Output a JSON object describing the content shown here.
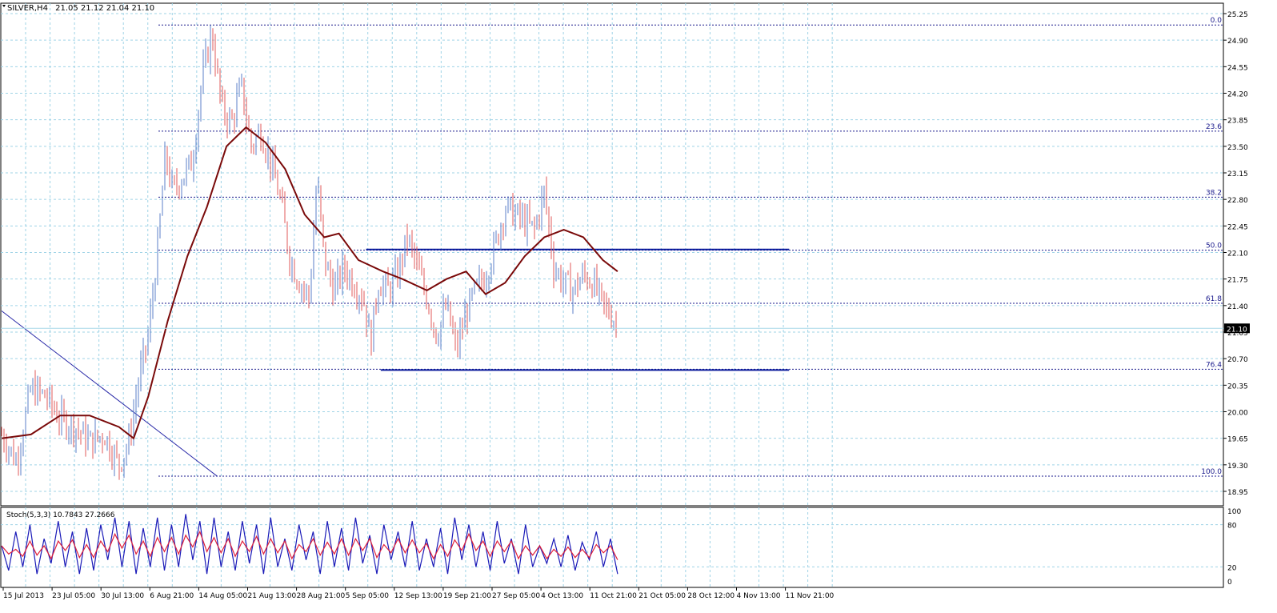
{
  "header": {
    "symbol_label": "SILVER,H4",
    "ohlc": "21.05 21.12 21.04 21.10"
  },
  "chart_data": {
    "type": "candlestick",
    "symbol": "SILVER",
    "timeframe": "H4",
    "last_ohlc": {
      "open": 21.05,
      "high": 21.12,
      "low": 21.04,
      "close": 21.1
    },
    "current_price_label": "21.10",
    "price_axis": {
      "ylim": [
        18.95,
        25.25
      ],
      "ticks": [
        "25.25",
        "24.90",
        "24.55",
        "24.20",
        "23.85",
        "23.50",
        "23.15",
        "22.80",
        "22.45",
        "22.10",
        "21.75",
        "21.40",
        "21.05",
        "20.70",
        "20.35",
        "20.00",
        "19.65",
        "19.30",
        "18.95"
      ]
    },
    "time_axis_labels": [
      "15 Jul 2013",
      "23 Jul 05:00",
      "30 Jul 13:00",
      "6 Aug 21:00",
      "14 Aug 05:00",
      "21 Aug 13:00",
      "28 Aug 21:00",
      "5 Sep 05:00",
      "12 Sep 13:00",
      "19 Sep 21:00",
      "27 Sep 05:00",
      "4 Oct 13:00",
      "11 Oct 21:00",
      "21 Oct 05:00",
      "28 Oct 12:00",
      "4 Nov 13:00",
      "11 Nov 21:00"
    ],
    "fibonacci": [
      {
        "label": "0.0",
        "price": 25.1
      },
      {
        "label": "23.6",
        "price": 23.7
      },
      {
        "label": "38.2",
        "price": 22.83
      },
      {
        "label": "50.0",
        "price": 22.13
      },
      {
        "label": "61.8",
        "price": 21.43
      },
      {
        "label": "76.4",
        "price": 20.56
      },
      {
        "label": "100.0",
        "price": 19.15
      }
    ],
    "horizontal_levels": [
      {
        "name": "resistance",
        "price": 22.14,
        "from_index": 5,
        "to_index": 13
      },
      {
        "name": "support",
        "price": 20.55,
        "from_index": 5.3,
        "to_index": 13
      }
    ],
    "trendline": {
      "from": {
        "index": 0,
        "price": 21.33
      },
      "to": {
        "index": 3.1,
        "price": 19.15
      }
    },
    "price_path": [
      {
        "i": 0.0,
        "p": 19.7
      },
      {
        "i": 0.3,
        "p": 19.35
      },
      {
        "i": 0.6,
        "p": 20.3
      },
      {
        "i": 0.9,
        "p": 20.2
      },
      {
        "i": 1.2,
        "p": 19.9
      },
      {
        "i": 1.5,
        "p": 19.8
      },
      {
        "i": 1.8,
        "p": 19.6
      },
      {
        "i": 2.1,
        "p": 19.7
      },
      {
        "i": 2.4,
        "p": 19.3
      },
      {
        "i": 2.6,
        "p": 19.6
      },
      {
        "i": 2.8,
        "p": 20.4
      },
      {
        "i": 3.0,
        "p": 21.0
      },
      {
        "i": 3.2,
        "p": 22.2
      },
      {
        "i": 3.35,
        "p": 23.4
      },
      {
        "i": 3.5,
        "p": 22.9
      },
      {
        "i": 3.7,
        "p": 23.1
      },
      {
        "i": 3.9,
        "p": 23.3
      },
      {
        "i": 4.1,
        "p": 24.4
      },
      {
        "i": 4.3,
        "p": 25.0
      },
      {
        "i": 4.5,
        "p": 24.0
      },
      {
        "i": 4.7,
        "p": 23.8
      },
      {
        "i": 4.9,
        "p": 24.3
      },
      {
        "i": 5.1,
        "p": 23.5
      },
      {
        "i": 5.3,
        "p": 23.7
      },
      {
        "i": 5.5,
        "p": 23.3
      },
      {
        "i": 5.7,
        "p": 22.8
      },
      {
        "i": 5.9,
        "p": 22.0
      },
      {
        "i": 6.1,
        "p": 21.7
      },
      {
        "i": 6.3,
        "p": 21.5
      },
      {
        "i": 6.45,
        "p": 23.1
      },
      {
        "i": 6.6,
        "p": 22.0
      },
      {
        "i": 6.8,
        "p": 21.6
      },
      {
        "i": 7.0,
        "p": 21.9
      },
      {
        "i": 7.2,
        "p": 21.7
      },
      {
        "i": 7.4,
        "p": 21.5
      },
      {
        "i": 7.55,
        "p": 20.9
      },
      {
        "i": 7.7,
        "p": 21.7
      },
      {
        "i": 7.9,
        "p": 21.6
      },
      {
        "i": 8.1,
        "p": 21.8
      },
      {
        "i": 8.3,
        "p": 22.3
      },
      {
        "i": 8.5,
        "p": 21.9
      },
      {
        "i": 8.7,
        "p": 21.5
      },
      {
        "i": 8.9,
        "p": 21.0
      },
      {
        "i": 9.1,
        "p": 21.4
      },
      {
        "i": 9.3,
        "p": 20.8
      },
      {
        "i": 9.5,
        "p": 21.3
      },
      {
        "i": 9.7,
        "p": 21.6
      },
      {
        "i": 9.9,
        "p": 21.8
      },
      {
        "i": 10.1,
        "p": 22.2
      },
      {
        "i": 10.3,
        "p": 22.7
      },
      {
        "i": 10.5,
        "p": 22.6
      },
      {
        "i": 10.7,
        "p": 22.5
      },
      {
        "i": 10.9,
        "p": 22.4
      },
      {
        "i": 11.1,
        "p": 22.9
      },
      {
        "i": 11.3,
        "p": 21.9
      },
      {
        "i": 11.5,
        "p": 21.7
      },
      {
        "i": 11.7,
        "p": 21.6
      },
      {
        "i": 11.9,
        "p": 21.8
      },
      {
        "i": 12.1,
        "p": 21.7
      },
      {
        "i": 12.3,
        "p": 21.4
      },
      {
        "i": 12.5,
        "p": 21.25
      },
      {
        "i": 12.6,
        "p": 21.1
      }
    ],
    "moving_average": [
      {
        "i": 0.0,
        "p": 19.65
      },
      {
        "i": 0.6,
        "p": 19.7
      },
      {
        "i": 1.2,
        "p": 19.95
      },
      {
        "i": 1.8,
        "p": 19.95
      },
      {
        "i": 2.4,
        "p": 19.8
      },
      {
        "i": 2.7,
        "p": 19.65
      },
      {
        "i": 3.0,
        "p": 20.2
      },
      {
        "i": 3.4,
        "p": 21.2
      },
      {
        "i": 3.8,
        "p": 22.05
      },
      {
        "i": 4.2,
        "p": 22.7
      },
      {
        "i": 4.6,
        "p": 23.5
      },
      {
        "i": 5.0,
        "p": 23.75
      },
      {
        "i": 5.4,
        "p": 23.55
      },
      {
        "i": 5.8,
        "p": 23.2
      },
      {
        "i": 6.2,
        "p": 22.6
      },
      {
        "i": 6.6,
        "p": 22.3
      },
      {
        "i": 6.9,
        "p": 22.35
      },
      {
        "i": 7.3,
        "p": 22.0
      },
      {
        "i": 7.8,
        "p": 21.85
      },
      {
        "i": 8.2,
        "p": 21.75
      },
      {
        "i": 8.7,
        "p": 21.6
      },
      {
        "i": 9.1,
        "p": 21.75
      },
      {
        "i": 9.5,
        "p": 21.85
      },
      {
        "i": 9.9,
        "p": 21.55
      },
      {
        "i": 10.3,
        "p": 21.7
      },
      {
        "i": 10.7,
        "p": 22.05
      },
      {
        "i": 11.1,
        "p": 22.3
      },
      {
        "i": 11.5,
        "p": 22.4
      },
      {
        "i": 11.9,
        "p": 22.3
      },
      {
        "i": 12.3,
        "p": 22.0
      },
      {
        "i": 12.6,
        "p": 21.85
      }
    ],
    "stochastic": {
      "label": "Stoch(5,3,3) 10.7843 27.2666",
      "ticks": [
        "100",
        "80",
        "20",
        "0"
      ],
      "ylim": [
        0,
        100
      ],
      "main": [
        50,
        15,
        70,
        20,
        80,
        10,
        60,
        25,
        85,
        20,
        70,
        10,
        75,
        15,
        80,
        30,
        90,
        20,
        85,
        10,
        75,
        20,
        90,
        15,
        80,
        20,
        95,
        30,
        85,
        10,
        90,
        20,
        70,
        15,
        85,
        25,
        80,
        10,
        90,
        20,
        60,
        15,
        80,
        30,
        70,
        10,
        85,
        20,
        75,
        15,
        90,
        25,
        65,
        10,
        80,
        30,
        70,
        20,
        85,
        15,
        60,
        20,
        75,
        10,
        90,
        30,
        80,
        20,
        70,
        15,
        85,
        25,
        60,
        10,
        80,
        20,
        50,
        25,
        60,
        20,
        65,
        15,
        55,
        30,
        70,
        20,
        60,
        10
      ]
    }
  }
}
